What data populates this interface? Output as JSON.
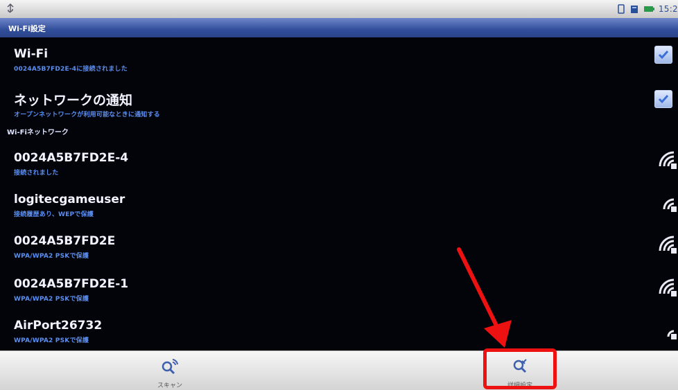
{
  "statusbar": {
    "time": "15:2"
  },
  "title": "Wi-Fi設定",
  "settings": {
    "wifi": {
      "label": "Wi-Fi",
      "sub": "0024A5B7FD2E-4に接続されました",
      "checked": true
    },
    "notify": {
      "label": "ネットワークの通知",
      "sub": "オープンネットワークが利用可能なときに通知する",
      "checked": true
    }
  },
  "networks_header": "Wi-Fiネットワーク",
  "networks": [
    {
      "ssid": "0024A5B7FD2E-4",
      "status": "接続されました"
    },
    {
      "ssid": "logitecgameuser",
      "status": "接続履歴あり、WEPで保護"
    },
    {
      "ssid": "0024A5B7FD2E",
      "status": "WPA/WPA2 PSKで保護"
    },
    {
      "ssid": "0024A5B7FD2E-1",
      "status": "WPA/WPA2 PSKで保護"
    },
    {
      "ssid": "AirPort26732",
      "status": "WPA/WPA2 PSKで保護"
    }
  ],
  "menu": {
    "scan": "スキャン",
    "advanced": "詳細設定"
  },
  "colors": {
    "annotation": "#ee1111",
    "accent": "#5a8ef0"
  }
}
